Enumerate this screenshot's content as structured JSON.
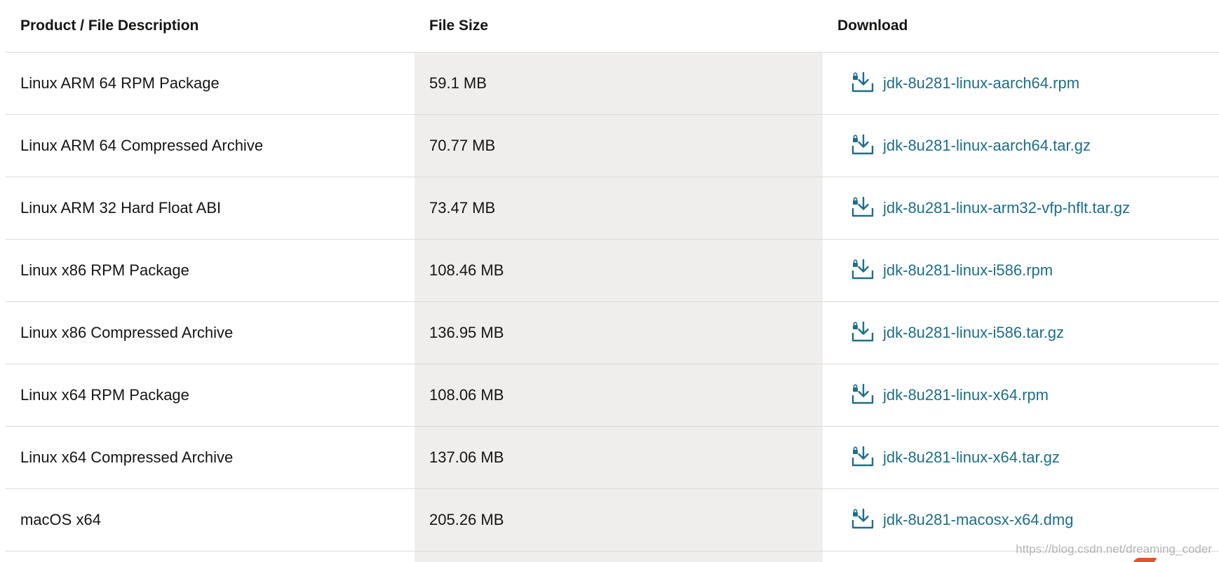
{
  "table": {
    "headers": {
      "description": "Product / File Description",
      "size": "File Size",
      "download": "Download"
    },
    "rows": [
      {
        "description": "Linux ARM 64 RPM Package",
        "size": "59.1 MB",
        "file": "jdk-8u281-linux-aarch64.rpm"
      },
      {
        "description": "Linux ARM 64 Compressed Archive",
        "size": "70.77 MB",
        "file": "jdk-8u281-linux-aarch64.tar.gz"
      },
      {
        "description": "Linux ARM 32 Hard Float ABI",
        "size": "73.47 MB",
        "file": "jdk-8u281-linux-arm32-vfp-hflt.tar.gz"
      },
      {
        "description": "Linux x86 RPM Package",
        "size": "108.46 MB",
        "file": "jdk-8u281-linux-i586.rpm"
      },
      {
        "description": "Linux x86 Compressed Archive",
        "size": "136.95 MB",
        "file": "jdk-8u281-linux-i586.tar.gz"
      },
      {
        "description": "Linux x64 RPM Package",
        "size": "108.06 MB",
        "file": "jdk-8u281-linux-x64.rpm"
      },
      {
        "description": "Linux x64 Compressed Archive",
        "size": "137.06 MB",
        "file": "jdk-8u281-linux-x64.tar.gz"
      },
      {
        "description": "macOS x64",
        "size": "205.26 MB",
        "file": "jdk-8u281-macosx-x64.dmg"
      }
    ]
  },
  "icons": {
    "download": "lock-download-icon"
  },
  "colors": {
    "link": "#1d6e8a",
    "size_column_bg": "#efeeec",
    "divider": "#dcdbd8"
  },
  "watermark": "https://blog.csdn.net/dreaming_coder"
}
